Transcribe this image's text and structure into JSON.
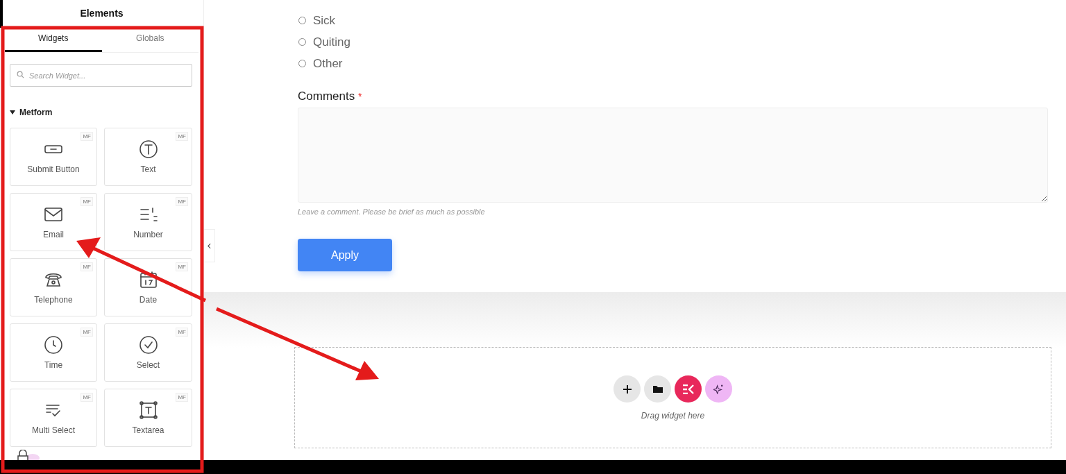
{
  "panel": {
    "title": "Elements",
    "tabs": [
      {
        "label": "Widgets",
        "selected": true
      },
      {
        "label": "Globals",
        "selected": false
      }
    ],
    "search": {
      "placeholder": "Search Widget..."
    },
    "category": {
      "name": "Metform",
      "expanded": true
    },
    "widgets": [
      {
        "label": "Submit Button",
        "badge": "MF",
        "kind": "button"
      },
      {
        "label": "Text",
        "badge": "MF",
        "kind": "text"
      },
      {
        "label": "Email",
        "badge": "MF",
        "kind": "email"
      },
      {
        "label": "Number",
        "badge": "MF",
        "kind": "number"
      },
      {
        "label": "Telephone",
        "badge": "MF",
        "kind": "telephone"
      },
      {
        "label": "Date",
        "badge": "MF",
        "kind": "date"
      },
      {
        "label": "Time",
        "badge": "MF",
        "kind": "time"
      },
      {
        "label": "Select",
        "badge": "MF",
        "kind": "select"
      },
      {
        "label": "Multi Select",
        "badge": "MF",
        "kind": "multiselect"
      },
      {
        "label": "Textarea",
        "badge": "MF",
        "kind": "textarea"
      }
    ]
  },
  "form": {
    "options": [
      {
        "label": "Sick",
        "selected": false
      },
      {
        "label": "Quiting",
        "selected": false
      },
      {
        "label": "Other",
        "selected": false
      }
    ],
    "comments": {
      "label": "Comments",
      "required_mark": "*",
      "hint": "Leave a comment. Please be brief as much as possible"
    },
    "submit": "Apply"
  },
  "drop_zone": {
    "text": "Drag widget here"
  }
}
